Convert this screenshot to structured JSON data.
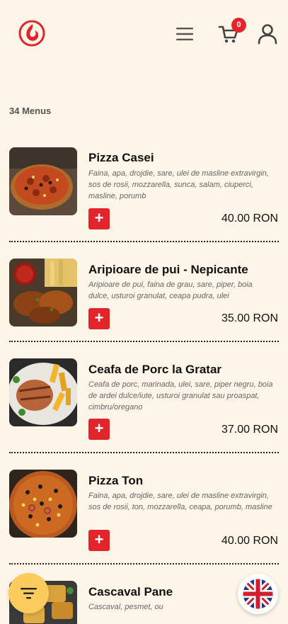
{
  "header": {
    "cart_count": "0"
  },
  "menus_count": "34 Menus",
  "items": [
    {
      "title": "Pizza Casei",
      "desc": "Faina, apa, drojdie, sare, ulei de masline extravirgin, sos de rosii, mozzarella, sunca, salam, ciuperci, masline, porumb",
      "price": "40.00 RON",
      "add": "+"
    },
    {
      "title": "Aripioare de pui - Nepicante",
      "desc": "Aripioare de pui, faina de grau, sare, piper, boia dulce, usturoi granulat, ceapa pudra, ulei",
      "price": "35.00 RON",
      "add": "+"
    },
    {
      "title": "Ceafa de Porc la Gratar",
      "desc": "Ceafa de porc, marinada, ulei, sare, piper negru, boia de ardei dulce/iute, usturoi granulat sau proaspat, cimbru/oregano",
      "price": "37.00 RON",
      "add": "+"
    },
    {
      "title": "Pizza Ton",
      "desc": "Faina, apa, drojdie, sare, ulei de masline extravirgin, sos de rosii, ton, mozzarella, ceapa, porumb, masline",
      "price": "40.00 RON",
      "add": "+"
    },
    {
      "title": "Cascaval Pane",
      "desc": "Cascaval, pesmet, ou"
    }
  ],
  "colors": {
    "background": "#fdf5e8",
    "accent_red": "#e2242b",
    "filter_yellow": "#fbcb5e"
  },
  "icons": {
    "logo": "flame-logo-icon",
    "menu": "hamburger-menu-icon",
    "cart": "shopping-cart-icon",
    "user": "user-icon",
    "filter": "filter-icon",
    "language": "uk-flag-icon"
  }
}
